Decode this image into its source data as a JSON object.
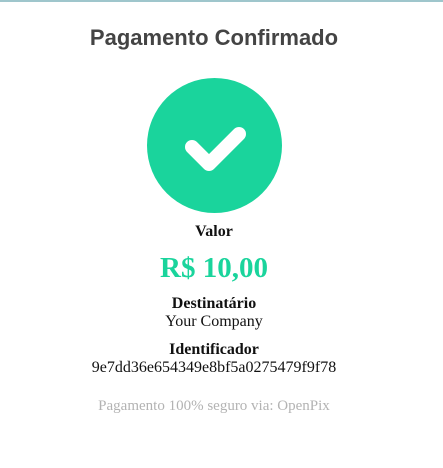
{
  "page": {
    "title": "Pagamento Confirmado",
    "icon": "check-circle-icon",
    "accent_color": "#1ad49c"
  },
  "payment": {
    "amount_label": "Valor",
    "amount": "R$ 10,00",
    "recipient_label": "Destinatário",
    "recipient": "Your Company",
    "identifier_label": "Identificador",
    "identifier": "9e7dd36e654349e8bf5a0275479f9f78"
  },
  "footer": {
    "text": "Pagamento 100% seguro via: OpenPix"
  }
}
